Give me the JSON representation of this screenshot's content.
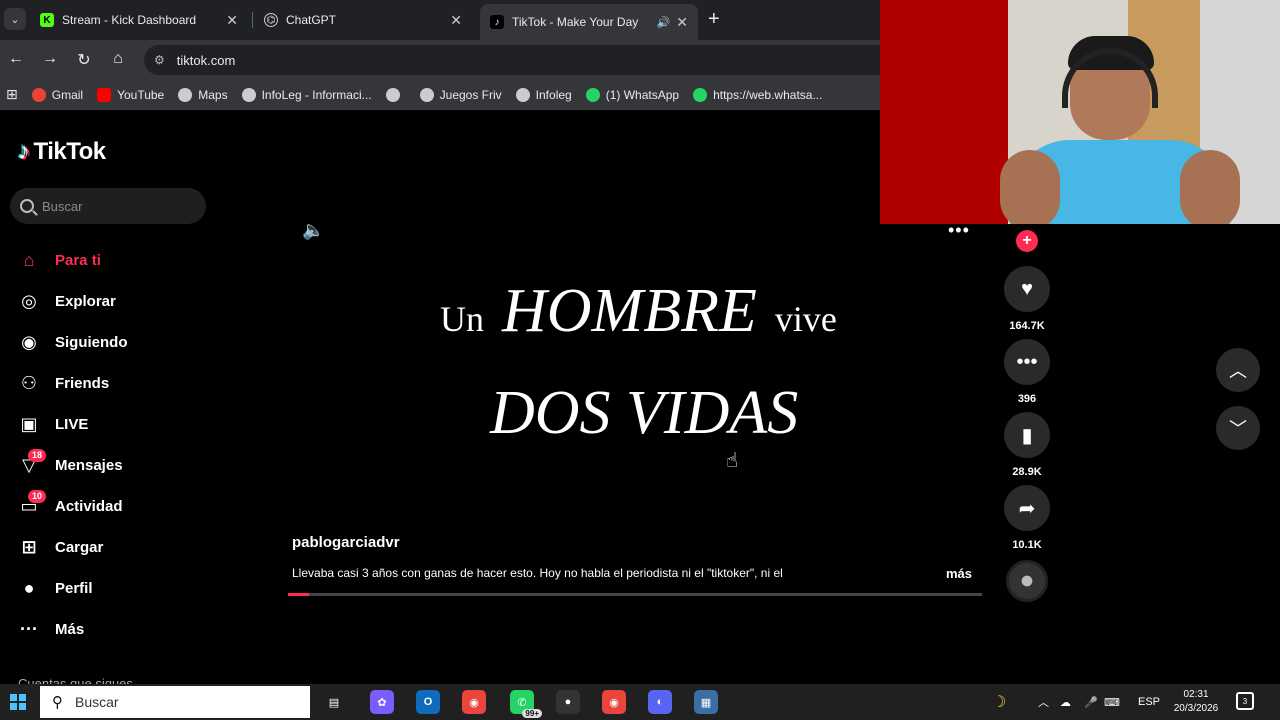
{
  "browser": {
    "tabs": [
      {
        "title": "Stream - Kick Dashboard",
        "favicon": "K",
        "favicon_color": "#53fc18",
        "active": false
      },
      {
        "title": "ChatGPT",
        "favicon": "⌬",
        "favicon_color": "#ffffff",
        "active": false
      },
      {
        "title": "TikTok - Make Your Day",
        "favicon": "♪",
        "favicon_color": "#ffffff",
        "active": true
      }
    ],
    "url": "tiktok.com",
    "bookmarks": [
      {
        "label": "Gmail",
        "color": "#ea4335"
      },
      {
        "label": "YouTube",
        "color": "#ff0000"
      },
      {
        "label": "Maps",
        "color": "#cccccc"
      },
      {
        "label": "InfoLeg - Informaci...",
        "color": "#cccccc"
      },
      {
        "label": "",
        "color": "#cccccc"
      },
      {
        "label": "Juegos Friv",
        "color": "#cccccc"
      },
      {
        "label": "Infoleg",
        "color": "#cccccc"
      },
      {
        "label": "(1) WhatsApp",
        "color": "#25d366"
      },
      {
        "label": "https://web.whatsa...",
        "color": "#25d366"
      }
    ]
  },
  "tiktok": {
    "logo": "TikTok",
    "search_placeholder": "Buscar",
    "nav": [
      {
        "label": "Para ti",
        "icon": "home-icon",
        "glyph": "⌂",
        "active": true,
        "badge": ""
      },
      {
        "label": "Explorar",
        "icon": "compass-icon",
        "glyph": "◎",
        "active": false,
        "badge": ""
      },
      {
        "label": "Siguiendo",
        "icon": "avatar-icon",
        "glyph": "◉",
        "active": false,
        "badge": ""
      },
      {
        "label": "Friends",
        "icon": "friends-icon",
        "glyph": "⚇",
        "active": false,
        "badge": ""
      },
      {
        "label": "LIVE",
        "icon": "live-icon",
        "glyph": "▣",
        "active": false,
        "badge": ""
      },
      {
        "label": "Mensajes",
        "icon": "messages-icon",
        "glyph": "▽",
        "active": false,
        "badge": "18"
      },
      {
        "label": "Actividad",
        "icon": "activity-icon",
        "glyph": "▭",
        "active": false,
        "badge": "10"
      },
      {
        "label": "Cargar",
        "icon": "upload-icon",
        "glyph": "⊞",
        "active": false,
        "badge": ""
      },
      {
        "label": "Perfil",
        "icon": "profile-icon",
        "glyph": "●",
        "active": false,
        "badge": ""
      },
      {
        "label": "Más",
        "icon": "more-icon",
        "glyph": "···",
        "active": false,
        "badge": ""
      }
    ],
    "cut_off_heading": "Cuentas que sigues",
    "video": {
      "text_line1_a": "Un",
      "text_line1_b": "HOMBRE",
      "text_line1_c": "vive",
      "text_line2": "DOS VIDAS",
      "author": "pablogarciadvr",
      "caption": "Llevaba casi 3 años con ganas de hacer esto. Hoy no habla el periodista ni el \"tiktoker\", ni el",
      "caption_more": "más",
      "progress_fraction": 0.03
    },
    "actions": {
      "likes": "164.7K",
      "comments": "396",
      "saves": "28.9K",
      "shares": "10.1K"
    }
  },
  "taskbar": {
    "search_placeholder": "Buscar",
    "apps": [
      {
        "name": "task-view-icon",
        "glyph": "▤",
        "color": "transparent",
        "badge": ""
      },
      {
        "name": "copilot-icon",
        "glyph": "✿",
        "color": "#7b5cff",
        "badge": ""
      },
      {
        "name": "outlook-icon",
        "glyph": "O",
        "color": "#0f6cbd",
        "badge": ""
      },
      {
        "name": "chrome-icon",
        "glyph": "◉",
        "color": "#e8453c",
        "badge": ""
      },
      {
        "name": "whatsapp-icon",
        "glyph": "✆",
        "color": "#25d366",
        "badge": "99+"
      },
      {
        "name": "obs-icon",
        "glyph": "●",
        "color": "#333333",
        "badge": ""
      },
      {
        "name": "chrome-profile-icon",
        "glyph": "◉",
        "color": "#e8453c",
        "badge": ""
      },
      {
        "name": "discord-icon",
        "glyph": "◐",
        "color": "#5865f2",
        "badge": ""
      },
      {
        "name": "notes-app-icon",
        "glyph": "▦",
        "color": "#3a6ea5",
        "badge": ""
      }
    ],
    "lang": "ESP",
    "time": "02:31",
    "date": "20/3/2026",
    "notifications": "3"
  }
}
